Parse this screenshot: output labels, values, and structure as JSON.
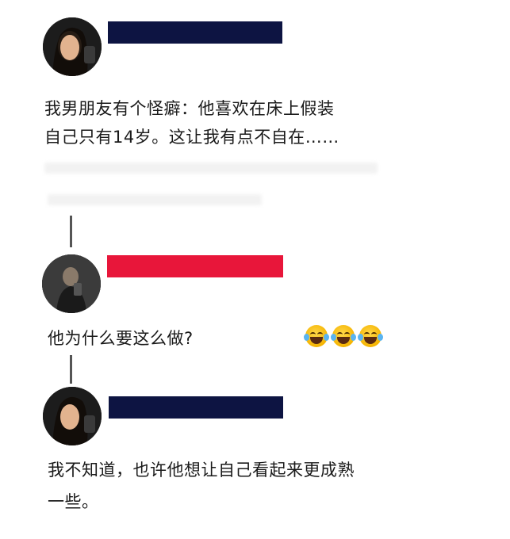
{
  "thread": [
    {
      "id": "post-1",
      "name_bar_color": "#0d1442",
      "text_lines": [
        "我男朋友有个怪癖：他喜欢在床上假装",
        "自己只有14岁。这让我有点不自在……"
      ]
    },
    {
      "id": "reply-1",
      "name_bar_color": "#e8163a",
      "text_lines": [
        "他为什么要这么做?"
      ],
      "emoji": [
        "laugh-cry-emoji",
        "laugh-cry-emoji",
        "laugh-cry-emoji"
      ]
    },
    {
      "id": "reply-2",
      "name_bar_color": "#0d1442",
      "text_lines": [
        "我不知道，也许他想让自己看起来更成熟",
        "一些。"
      ]
    }
  ]
}
